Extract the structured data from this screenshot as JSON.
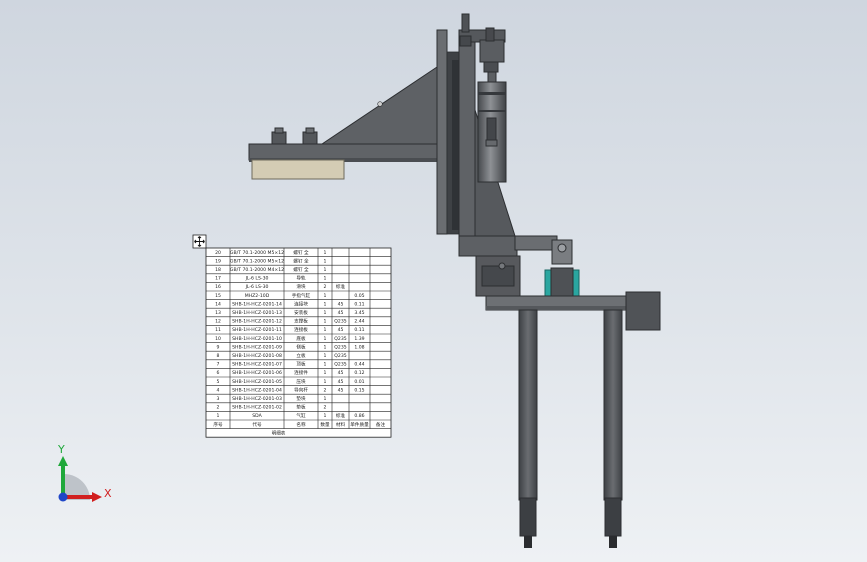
{
  "viewport": {
    "background_top": "#cfd6df",
    "background_bottom": "#eef1f4",
    "model_color": "#5b5e62",
    "model_dark": "#3c3f43",
    "model_light": "#8a8d91",
    "tan_color": "#d4ccb4",
    "teal_color": "#2aa6a0"
  },
  "bom_table": {
    "anchor_icon": "move-handle-icon",
    "rows": [
      {
        "no": "20",
        "code": "GB/T 70.1-2000 M5×12",
        "name": "螺钉 全",
        "qty": "1",
        "mat": "",
        "weight": "",
        "note": ""
      },
      {
        "no": "19",
        "code": "GB/T 70.1-2000 M5×12",
        "name": "螺钉 全",
        "qty": "1",
        "mat": "",
        "weight": "",
        "note": ""
      },
      {
        "no": "18",
        "code": "GB/T 70.1-2000 M4×12",
        "name": "螺钉 全",
        "qty": "1",
        "mat": "",
        "weight": "",
        "note": ""
      },
      {
        "no": "17",
        "code": "JL-6 LS-30",
        "name": "导轨",
        "qty": "1",
        "mat": "",
        "weight": "",
        "note": ""
      },
      {
        "no": "16",
        "code": "JL-6 LS-30",
        "name": "滑块",
        "qty": "2",
        "mat": "标准",
        "weight": "",
        "note": ""
      },
      {
        "no": "15",
        "code": "MHZ2-10D",
        "name": "手指气缸",
        "qty": "1",
        "mat": "",
        "weight": "0.05",
        "note": ""
      },
      {
        "no": "14",
        "code": "SHB-1H-HCZ-0201-14",
        "name": "连接块",
        "qty": "1",
        "mat": "45",
        "weight": "0.11",
        "note": ""
      },
      {
        "no": "13",
        "code": "SHB-1H-HCZ-0201-13",
        "name": "安装板",
        "qty": "1",
        "mat": "45",
        "weight": "3.45",
        "note": ""
      },
      {
        "no": "12",
        "code": "SHB-1H-HCZ-0201-12",
        "name": "支撑板",
        "qty": "1",
        "mat": "Q235",
        "weight": "2.44",
        "note": ""
      },
      {
        "no": "11",
        "code": "SHB-1H-HCZ-0201-11",
        "name": "连接板",
        "qty": "1",
        "mat": "45",
        "weight": "0.11",
        "note": ""
      },
      {
        "no": "10",
        "code": "SHB-1H-HCZ-0201-10",
        "name": "底板",
        "qty": "1",
        "mat": "Q235",
        "weight": "1.39",
        "note": ""
      },
      {
        "no": "9",
        "code": "SHB-1H-HCZ-0201-09",
        "name": "侧板",
        "qty": "1",
        "mat": "Q235",
        "weight": "1.08",
        "note": ""
      },
      {
        "no": "8",
        "code": "SHB-1H-HCZ-0201-08",
        "name": "立板",
        "qty": "1",
        "mat": "Q235",
        "weight": "",
        "note": ""
      },
      {
        "no": "7",
        "code": "SHB-1H-HCZ-0201-07",
        "name": "顶板",
        "qty": "1",
        "mat": "Q235",
        "weight": "0.44",
        "note": ""
      },
      {
        "no": "6",
        "code": "SHB-1H-HCZ-0201-06",
        "name": "连接件",
        "qty": "1",
        "mat": "45",
        "weight": "0.12",
        "note": ""
      },
      {
        "no": "5",
        "code": "SHB-1H-HCZ-0201-05",
        "name": "压块",
        "qty": "1",
        "mat": "45",
        "weight": "0.01",
        "note": ""
      },
      {
        "no": "4",
        "code": "SHB-1H-HCZ-0201-04",
        "name": "导向杆",
        "qty": "2",
        "mat": "45",
        "weight": "0.15",
        "note": ""
      },
      {
        "no": "3",
        "code": "SHB-1H-HCZ-0201-03",
        "name": "垫块",
        "qty": "1",
        "mat": "",
        "weight": "",
        "note": ""
      },
      {
        "no": "2",
        "code": "SHB-1H-HCZ-0201-02",
        "name": "垫板",
        "qty": "2",
        "mat": "",
        "weight": "",
        "note": ""
      },
      {
        "no": "1",
        "code": "SDA",
        "name": "气缸",
        "qty": "1",
        "mat": "标准",
        "weight": "0.86",
        "note": ""
      }
    ],
    "header": {
      "no": "序号",
      "code": "代号",
      "name": "名称",
      "qty": "数量",
      "mat": "材料",
      "weight": "单件质量",
      "note": "备注"
    },
    "footer": "明细表"
  },
  "triad": {
    "x_label": "X",
    "y_label": "Y",
    "x_color": "#d11f1f",
    "y_color": "#1fa83a",
    "z_color": "#2047c8"
  }
}
